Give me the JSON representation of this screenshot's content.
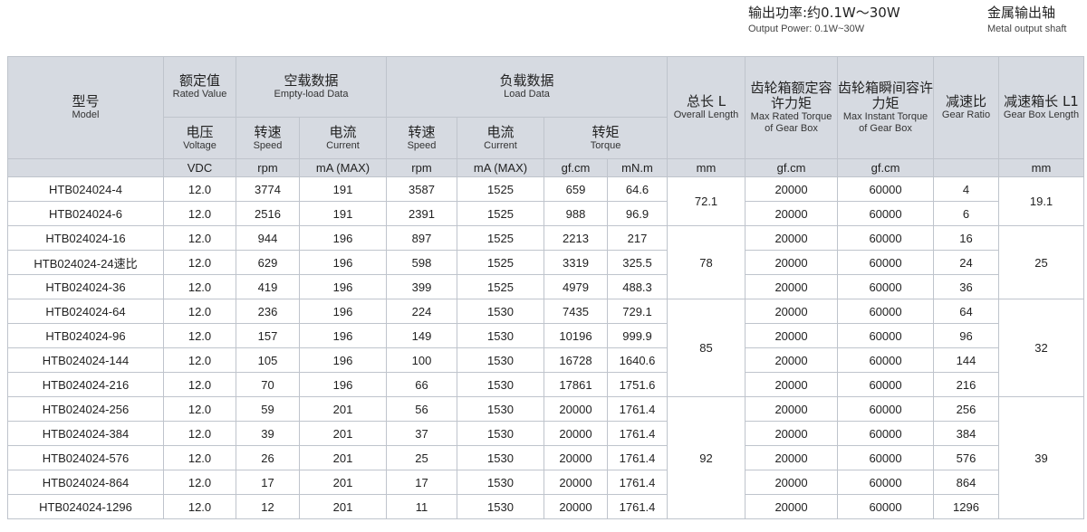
{
  "features": [
    {
      "cn": "输出功率:约0.1W～30W",
      "en": "Output Power: 0.1W~30W"
    },
    {
      "cn": "金属输出轴",
      "en": "Metal output shaft"
    }
  ],
  "headers": {
    "model": {
      "cn": "型号",
      "en": "Model"
    },
    "rated": {
      "cn": "额定值",
      "en": "Rated Value"
    },
    "empty": {
      "cn": "空载数据",
      "en": "Empty-load Data"
    },
    "load": {
      "cn": "负载数据",
      "en": "Load Data"
    },
    "length": {
      "cn": "总长 L",
      "en": "Overall Length"
    },
    "rated_torque": {
      "cn": "齿轮箱额定容许力矩",
      "en": "Max Rated Torque of Gear Box"
    },
    "instant_torque": {
      "cn": "齿轮箱瞬间容许力矩",
      "en": "Max Instant Torque of Gear Box"
    },
    "ratio": {
      "cn": "减速比",
      "en": "Gear Ratio"
    },
    "gb_length": {
      "cn": "减速箱长 L1",
      "en": "Gear Box Length"
    },
    "voltage": {
      "cn": "电压",
      "en": "Voltage"
    },
    "speed": {
      "cn": "转速",
      "en": "Speed"
    },
    "current": {
      "cn": "电流",
      "en": "Current"
    },
    "torque": {
      "cn": "转矩",
      "en": "Torque"
    }
  },
  "units": [
    "VDC",
    "rpm",
    "mA (MAX)",
    "rpm",
    "mA (MAX)",
    "gf.cm",
    "mN.m",
    "mm",
    "gf.cm",
    "gf.cm",
    "",
    "mm"
  ],
  "rows": [
    [
      "HTB024024-4",
      "12.0",
      "3774",
      "191",
      "3587",
      "1525",
      "659",
      "64.6",
      "20000",
      "60000",
      "4"
    ],
    [
      "HTB024024-6",
      "12.0",
      "2516",
      "191",
      "2391",
      "1525",
      "988",
      "96.9",
      "20000",
      "60000",
      "6"
    ],
    [
      "HTB024024-16",
      "12.0",
      "944",
      "196",
      "897",
      "1525",
      "2213",
      "217",
      "20000",
      "60000",
      "16"
    ],
    [
      "HTB024024-24速比",
      "12.0",
      "629",
      "196",
      "598",
      "1525",
      "3319",
      "325.5",
      "20000",
      "60000",
      "24"
    ],
    [
      "HTB024024-36",
      "12.0",
      "419",
      "196",
      "399",
      "1525",
      "4979",
      "488.3",
      "20000",
      "60000",
      "36"
    ],
    [
      "HTB024024-64",
      "12.0",
      "236",
      "196",
      "224",
      "1530",
      "7435",
      "729.1",
      "20000",
      "60000",
      "64"
    ],
    [
      "HTB024024-96",
      "12.0",
      "157",
      "196",
      "149",
      "1530",
      "10196",
      "999.9",
      "20000",
      "60000",
      "96"
    ],
    [
      "HTB024024-144",
      "12.0",
      "105",
      "196",
      "100",
      "1530",
      "16728",
      "1640.6",
      "20000",
      "60000",
      "144"
    ],
    [
      "HTB024024-216",
      "12.0",
      "70",
      "196",
      "66",
      "1530",
      "17861",
      "1751.6",
      "20000",
      "60000",
      "216"
    ],
    [
      "HTB024024-256",
      "12.0",
      "59",
      "201",
      "56",
      "1530",
      "20000",
      "1761.4",
      "20000",
      "60000",
      "256"
    ],
    [
      "HTB024024-384",
      "12.0",
      "39",
      "201",
      "37",
      "1530",
      "20000",
      "1761.4",
      "20000",
      "60000",
      "384"
    ],
    [
      "HTB024024-576",
      "12.0",
      "26",
      "201",
      "25",
      "1530",
      "20000",
      "1761.4",
      "20000",
      "60000",
      "576"
    ],
    [
      "HTB024024-864",
      "12.0",
      "17",
      "201",
      "17",
      "1530",
      "20000",
      "1761.4",
      "20000",
      "60000",
      "864"
    ],
    [
      "HTB024024-1296",
      "12.0",
      "12",
      "201",
      "11",
      "1530",
      "20000",
      "1761.4",
      "20000",
      "60000",
      "1296"
    ]
  ],
  "length_groups": [
    {
      "value": "72.1",
      "span": 2
    },
    {
      "value": "78",
      "span": 3
    },
    {
      "value": "85",
      "span": 4
    },
    {
      "value": "92",
      "span": 5
    }
  ],
  "gb_length_groups": [
    {
      "value": "19.1",
      "span": 2
    },
    {
      "value": "25",
      "span": 3
    },
    {
      "value": "32",
      "span": 4
    },
    {
      "value": "39",
      "span": 5
    }
  ]
}
